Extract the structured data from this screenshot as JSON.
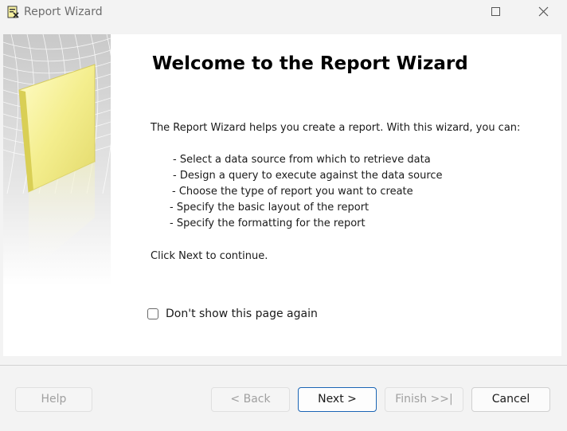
{
  "window": {
    "title": "Report Wizard",
    "app_icon": "report-wizard-icon"
  },
  "welcome": {
    "heading": "Welcome to the Report Wizard",
    "intro": "The Report Wizard helps you create a report. With this wizard, you can:",
    "bullets": [
      "- Select a data source from which to retrieve data",
      "- Design a query to execute against the data source",
      "- Choose the type of report you want to create",
      "- Specify the basic layout of the report",
      "- Specify the formatting for the report"
    ],
    "continue_text": "Click Next to continue."
  },
  "options": {
    "dont_show_label": "Don't show this page again",
    "dont_show_checked": false
  },
  "buttons": {
    "help": "Help",
    "back": "< Back",
    "next": "Next >",
    "finish": "Finish >>|",
    "cancel": "Cancel"
  },
  "colors": {
    "accent": "#1a64b4",
    "disabled_text": "#a0a0a0",
    "panel": "#ffffff",
    "background": "#f3f3f3"
  }
}
